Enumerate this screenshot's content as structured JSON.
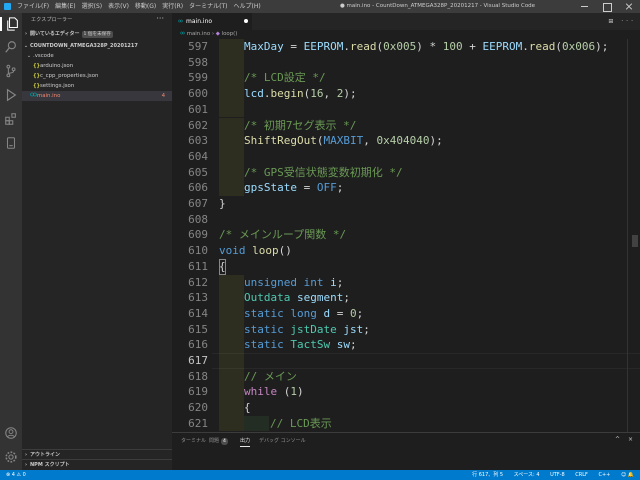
{
  "titlebar": {
    "menu": [
      "ファイル(F)",
      "編集(E)",
      "選択(S)",
      "表示(V)",
      "移動(G)",
      "実行(R)",
      "ターミナル(T)",
      "ヘルプ(H)"
    ],
    "title": "● main.ino - CountDown_ATMEGA328P_20201217 - Visual Studio Code"
  },
  "sidebar": {
    "title": "エクスプローラー",
    "more": "···",
    "open_editors": {
      "label": "開いているエディター",
      "badge": "1 個を未保存"
    },
    "project": "COUNTDOWN_ATMEGA328P_20201217",
    "folder": ".vscode",
    "files": [
      {
        "name": "arduino.json",
        "icon": "{}"
      },
      {
        "name": "c_cpp_properties.json",
        "icon": "{}"
      },
      {
        "name": "settings.json",
        "icon": "{}"
      }
    ],
    "main_file": {
      "name": "main.ino",
      "errors": "4"
    },
    "outline": "アウトライン",
    "npm": "NPM スクリプト"
  },
  "tab": {
    "label": "main.ino"
  },
  "tabs_actions": "⊞ ···",
  "breadcrumbs": {
    "file": "main.ino",
    "sep": "›",
    "symbol": "loop()"
  },
  "code": {
    "l597": {
      "num": "597",
      "a": "MaxDay",
      "b": " = ",
      "c": "EEPROM",
      "d": ".",
      "e": "read",
      "f": "(",
      "g": "0x005",
      "h": ") * ",
      "i": "100",
      "j": " + ",
      "k": "EEPROM",
      "l": ".",
      "m": "read",
      "n": "(",
      "o": "0x006",
      "p": ");"
    },
    "l598": {
      "num": "598"
    },
    "l599": {
      "num": "599",
      "c": "/* LCD設定 */"
    },
    "l600": {
      "num": "600",
      "a": "lcd",
      "b": ".",
      "c": "begin",
      "d": "(",
      "e": "16",
      "f": ", ",
      "g": "2",
      "h": ");"
    },
    "l601": {
      "num": "601"
    },
    "l602": {
      "num": "602",
      "c": "/* 初期7セグ表示 */"
    },
    "l603": {
      "num": "603",
      "a": "ShiftRegOut",
      "b": "(",
      "c": "MAXBIT",
      "d": ", ",
      "e": "0x404040",
      "f": ");"
    },
    "l604": {
      "num": "604"
    },
    "l605": {
      "num": "605",
      "c": "/* GPS受信状態変数初期化 */"
    },
    "l606": {
      "num": "606",
      "a": "gpsState",
      "b": " = ",
      "c": "OFF",
      "d": ";"
    },
    "l607": {
      "num": "607",
      "a": "}"
    },
    "l608": {
      "num": "608"
    },
    "l609": {
      "num": "609",
      "c": "/* メインループ関数 */"
    },
    "l610": {
      "num": "610",
      "a": "void",
      "b": " ",
      "c": "loop",
      "d": "()"
    },
    "l611": {
      "num": "611",
      "a": "{"
    },
    "l612": {
      "num": "612",
      "a": "unsigned",
      "b": " ",
      "c": "int",
      "d": " ",
      "e": "i",
      "f": ";"
    },
    "l613": {
      "num": "613",
      "a": "Outdata",
      "b": " ",
      "c": "segment",
      "d": ";"
    },
    "l614": {
      "num": "614",
      "a": "static",
      "b": " ",
      "c": "long",
      "d": " ",
      "e": "d",
      "f": " = ",
      "g": "0",
      "h": ";"
    },
    "l615": {
      "num": "615",
      "a": "static",
      "b": " ",
      "c": "jstDate",
      "d": " ",
      "e": "jst",
      "f": ";"
    },
    "l616": {
      "num": "616",
      "a": "static",
      "b": " ",
      "c": "TactSw",
      "d": " ",
      "e": "sw",
      "f": ";"
    },
    "l617": {
      "num": "617"
    },
    "l618": {
      "num": "618",
      "c": "// メイン"
    },
    "l619": {
      "num": "619",
      "a": "while",
      "b": " (",
      "c": "1",
      "d": ")"
    },
    "l620": {
      "num": "620",
      "a": "{"
    },
    "l621": {
      "num": "621",
      "c": "// LCD表示"
    }
  },
  "panel": {
    "tabs": [
      "ターミナル",
      "問題",
      "出力",
      "デバッグ コンソール"
    ],
    "problems_count": "4",
    "actions": "^ ×"
  },
  "status": {
    "left": "⊗ 4  ⚠ 0",
    "position": "行 617、列 5",
    "spaces": "スペース: 4",
    "encoding": "UTF-8",
    "eol": "CRLF",
    "language": "C++",
    "icons": "☺ 🔔"
  }
}
